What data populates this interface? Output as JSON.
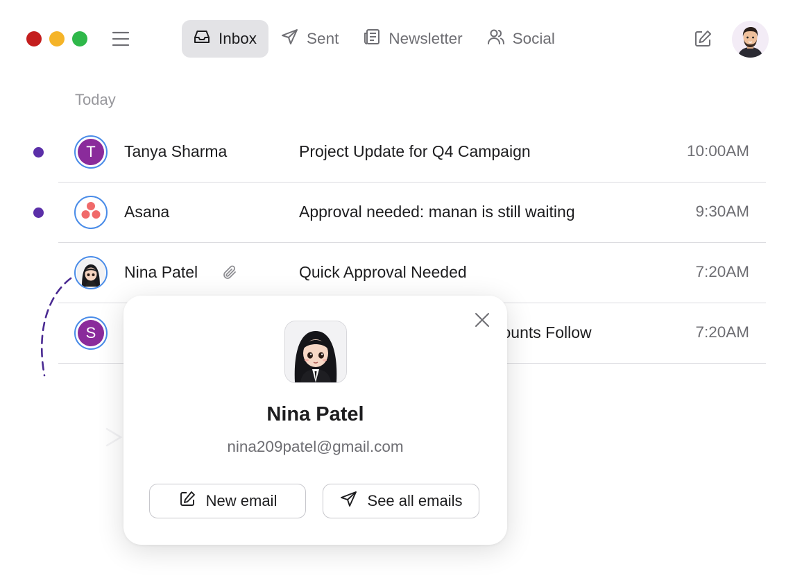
{
  "header": {
    "tabs": [
      {
        "label": "Inbox",
        "icon": "inbox-icon",
        "active": true
      },
      {
        "label": "Sent",
        "icon": "send-icon",
        "active": false
      },
      {
        "label": "Newsletter",
        "icon": "newsletter-icon",
        "active": false
      },
      {
        "label": "Social",
        "icon": "users-icon",
        "active": false
      }
    ]
  },
  "list": {
    "section_label": "Today",
    "emails": [
      {
        "sender": "Tanya Sharma",
        "initial": "T",
        "subject": "Project Update for Q4 Campaign",
        "time": "10:00AM",
        "unread": true
      },
      {
        "sender": "Asana",
        "initial": "",
        "subject": "Approval needed: manan is still waiting",
        "time": "9:30AM",
        "unread": true
      },
      {
        "sender": "Nina Patel",
        "initial": "",
        "subject": "Quick Approval Needed",
        "time": "7:20AM",
        "unread": false,
        "attachment": true
      },
      {
        "sender": "",
        "initial": "S",
        "subject": "counts Follow",
        "time": "7:20AM",
        "unread": false
      }
    ]
  },
  "contact_card": {
    "name": "Nina Patel",
    "email": "nina209patel@gmail.com",
    "new_email_label": "New email",
    "see_all_label": "See all emails"
  },
  "colors": {
    "unread_dot": "#5b2fa8",
    "avatar_ring": "#4a8ce8",
    "avatar_fill": "#8a2b9b",
    "active_tab_bg": "#e3e3e6"
  }
}
